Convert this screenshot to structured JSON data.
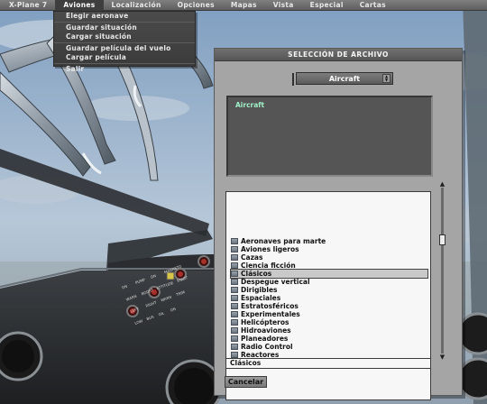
{
  "menubar": {
    "items": [
      {
        "label": "X-Plane 7"
      },
      {
        "label": "Aviones"
      },
      {
        "label": "Localización"
      },
      {
        "label": "Opciones"
      },
      {
        "label": "Mapas"
      },
      {
        "label": "Vista"
      },
      {
        "label": "Especial"
      },
      {
        "label": "Cartas"
      }
    ],
    "active_index": 1
  },
  "aviones_menu": {
    "items": [
      "Elegir aeronave",
      "Guardar situación",
      "Cargar situación",
      "Guardar película del vuelo",
      "Cargar película",
      "Salir"
    ]
  },
  "dialog": {
    "title": "SELECCIÓN DE ARCHIVO",
    "folder_select": {
      "value": "Aircraft"
    },
    "preview_label": "Aircraft",
    "files": [
      "Aeronaves para marte",
      "Aviones ligeros",
      "Cazas",
      "Ciencia ficción",
      "Clásicos",
      "Despegue vertical",
      "Dirigibles",
      "Espaciales",
      "Estratosféricos",
      "Experimentales",
      "Helicópteros",
      "Hidroaviones",
      "Planeadores",
      "Radio Control",
      "Reactores"
    ],
    "selected_file": "Clásicos",
    "filename_field": "Clásicos",
    "cancel_label": "Cancelar"
  },
  "cockpit_panel": {
    "labels": [
      "LOW",
      "BUS",
      "OIL",
      "ON",
      "LEFT",
      "RIGHT",
      "WARN",
      "TRIM",
      "WARN",
      "BOOST",
      "ATTITUDE",
      "START",
      "ON",
      "PUMP",
      "DN",
      "MAGNETO"
    ]
  },
  "icons": {
    "file_icon": "folder-icon",
    "scroll_up": "arrow-up-icon",
    "scroll_down": "arrow-down-icon",
    "select_arrows": "up-down-arrows-icon"
  },
  "colors": {
    "menubar_bg": "#6e6e6e",
    "dialog_bg": "#a5a5a5",
    "preview_label": "#9ff0c6",
    "sky": "#8aa7c4"
  }
}
